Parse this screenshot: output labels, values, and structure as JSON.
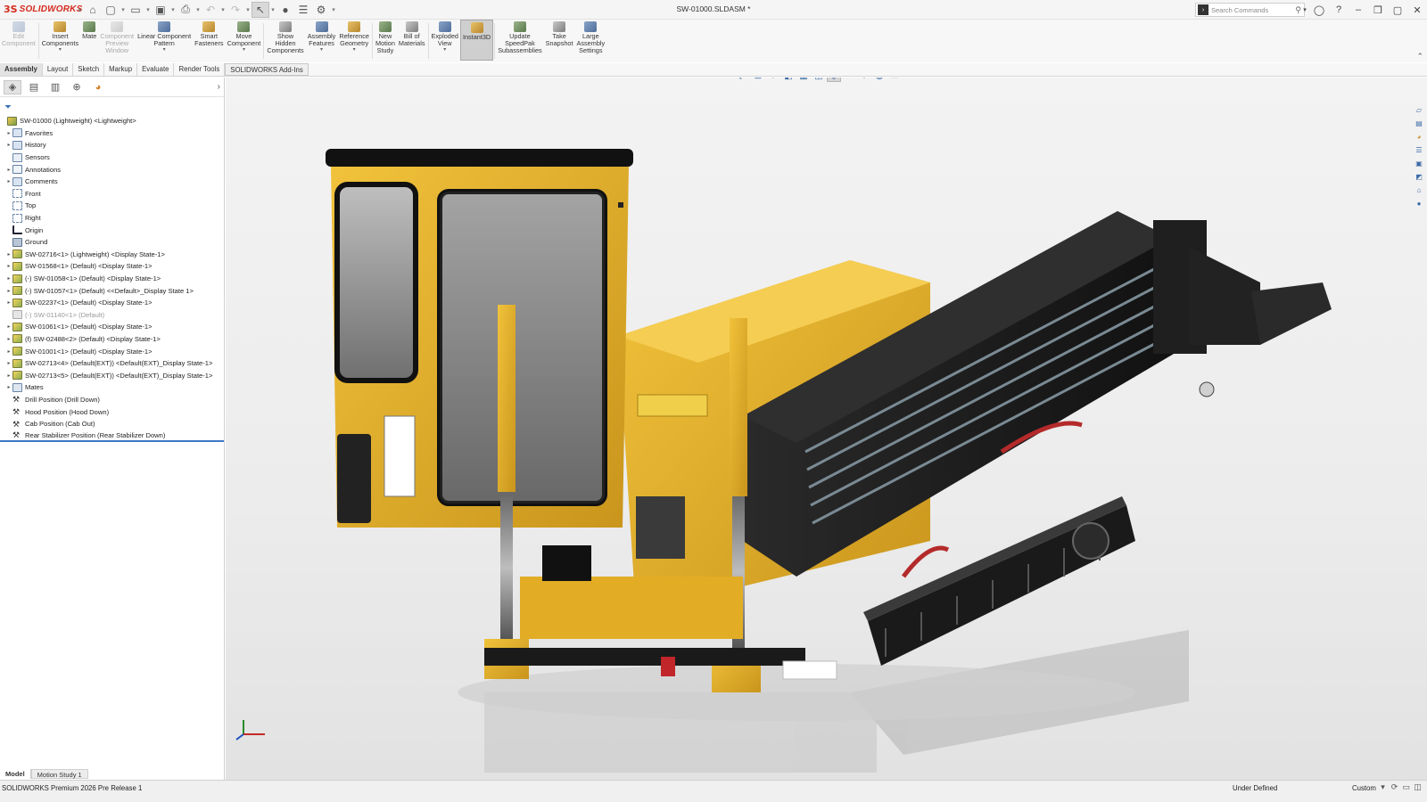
{
  "app": {
    "brand_mark": "3S",
    "brand_name": "SOLIDWORKS",
    "document_title": "SW-01000.SLDASM *"
  },
  "search": {
    "placeholder": "Search Commands"
  },
  "ribbon": [
    {
      "key": "edit-component",
      "label": "Edit\nComponent",
      "disabled": true,
      "icon": "edit-component-icon"
    },
    {
      "key": "insert-components",
      "label": "Insert\nComponents",
      "dropdown": true,
      "icon": "insert-components-icon"
    },
    {
      "key": "mate",
      "label": "Mate",
      "icon": "mate-icon"
    },
    {
      "key": "component-preview-window",
      "label": "Component\nPreview\nWindow",
      "disabled": true,
      "icon": "preview-window-icon"
    },
    {
      "key": "linear-component-pattern",
      "label": "Linear Component\nPattern",
      "dropdown": true,
      "icon": "linear-pattern-icon"
    },
    {
      "key": "smart-fasteners",
      "label": "Smart\nFasteners",
      "icon": "smart-fasteners-icon"
    },
    {
      "key": "move-component",
      "label": "Move\nComponent",
      "dropdown": true,
      "icon": "move-component-icon"
    },
    {
      "key": "show-hidden-components",
      "label": "Show\nHidden\nComponents",
      "icon": "show-hidden-icon"
    },
    {
      "key": "assembly-features",
      "label": "Assembly\nFeatures",
      "dropdown": true,
      "icon": "assembly-features-icon"
    },
    {
      "key": "reference-geometry",
      "label": "Reference\nGeometry",
      "dropdown": true,
      "icon": "reference-geometry-icon"
    },
    {
      "key": "new-motion-study",
      "label": "New\nMotion\nStudy",
      "icon": "motion-study-icon"
    },
    {
      "key": "bill-of-materials",
      "label": "Bill of\nMaterials",
      "icon": "bom-icon"
    },
    {
      "key": "exploded-view",
      "label": "Exploded\nView",
      "dropdown": true,
      "icon": "exploded-view-icon"
    },
    {
      "key": "instant3d",
      "label": "Instant3D",
      "active": true,
      "icon": "instant3d-icon"
    },
    {
      "key": "update-speedpak",
      "label": "Update\nSpeedPak\nSubassemblies",
      "icon": "speedpak-icon"
    },
    {
      "key": "take-snapshot",
      "label": "Take\nSnapshot",
      "icon": "snapshot-icon"
    },
    {
      "key": "large-assembly-settings",
      "label": "Large\nAssembly\nSettings",
      "icon": "large-assembly-icon"
    }
  ],
  "command_tabs": [
    "Assembly",
    "Layout",
    "Sketch",
    "Markup",
    "Evaluate",
    "Render Tools",
    "SOLIDWORKS Add-Ins"
  ],
  "active_command_tab": "Assembly",
  "panel_tabs": [
    "featuremanager-icon",
    "propertymanager-icon",
    "configurationmanager-icon",
    "dimxpert-icon",
    "display-manager-icon"
  ],
  "tree": [
    {
      "label": "SW-01000 (Lightweight) <Lightweight>",
      "icon": "root",
      "expander": "",
      "level": 0
    },
    {
      "label": "Favorites",
      "icon": "folder",
      "expander": "▸",
      "level": 1
    },
    {
      "label": "History",
      "icon": "folder",
      "expander": "▸",
      "level": 1
    },
    {
      "label": "Sensors",
      "icon": "sens",
      "expander": "",
      "level": 1
    },
    {
      "label": "Annotations",
      "icon": "ann",
      "expander": "▸",
      "level": 1
    },
    {
      "label": "Comments",
      "icon": "folder",
      "expander": "▸",
      "level": 1
    },
    {
      "label": "Front",
      "icon": "plane",
      "expander": "",
      "level": 1
    },
    {
      "label": "Top",
      "icon": "plane",
      "expander": "",
      "level": 1
    },
    {
      "label": "Right",
      "icon": "plane",
      "expander": "",
      "level": 1
    },
    {
      "label": "Origin",
      "icon": "origin",
      "expander": "",
      "level": 1
    },
    {
      "label": "Ground",
      "icon": "ground",
      "expander": "",
      "level": 1
    },
    {
      "label": "SW-02716<1> (Lightweight) <Display State-1>",
      "icon": "part",
      "expander": "▸",
      "level": 1
    },
    {
      "label": "SW-01568<1> (Default) <Display State-1>",
      "icon": "part",
      "expander": "▸",
      "level": 1
    },
    {
      "label": "(-) SW-01058<1> (Default) <Display State-1>",
      "icon": "part",
      "expander": "▸",
      "level": 1
    },
    {
      "label": "(-) SW-01057<1> (Default) <<Default>_Display State 1>",
      "icon": "part",
      "expander": "▸",
      "level": 1
    },
    {
      "label": "SW-02237<1> (Default) <Display State-1>",
      "icon": "part",
      "expander": "▸",
      "level": 1
    },
    {
      "label": "(-) SW-01140<1> (Default)",
      "icon": "suppressed",
      "expander": "",
      "level": 1,
      "dim": true
    },
    {
      "label": "SW-01061<1> (Default) <Display State-1>",
      "icon": "part",
      "expander": "▸",
      "level": 1
    },
    {
      "label": "(f) SW-02488<2> (Default) <Display State-1>",
      "icon": "part",
      "expander": "▸",
      "level": 1
    },
    {
      "label": "SW-01001<1> (Default) <Display State-1>",
      "icon": "part",
      "expander": "▸",
      "level": 1
    },
    {
      "label": "SW-02713<4> (Default(EXT)) <Default(EXT)_Display State-1>",
      "icon": "part",
      "expander": "▸",
      "level": 1
    },
    {
      "label": "SW-02713<5> (Default(EXT)) <Default(EXT)_Display State-1>",
      "icon": "part",
      "expander": "▸",
      "level": 1
    },
    {
      "label": "Mates",
      "icon": "mates",
      "expander": "▸",
      "level": 1
    },
    {
      "label": "Drill Position (Drill Down)",
      "icon": "config",
      "expander": "",
      "level": 1
    },
    {
      "label": "Hood Position (Hood Down)",
      "icon": "config",
      "expander": "",
      "level": 1
    },
    {
      "label": "Cab Position (Cab Out)",
      "icon": "config",
      "expander": "",
      "level": 1
    },
    {
      "label": "Rear Stabilizer Position (Rear Stabilizer Down)",
      "icon": "config",
      "expander": "",
      "level": 1
    }
  ],
  "bottom_tabs": {
    "model": "Model",
    "motion_study": "Motion Study 1"
  },
  "status": {
    "version": "SOLIDWORKS Premium 2026 Pre Release 1",
    "state": "Under Defined",
    "units": "Custom"
  },
  "colors": {
    "accent": "#3d78c5",
    "brand": "#d52b1e",
    "machine_yellow": "#e9b528",
    "machine_black": "#1d1d1d"
  }
}
